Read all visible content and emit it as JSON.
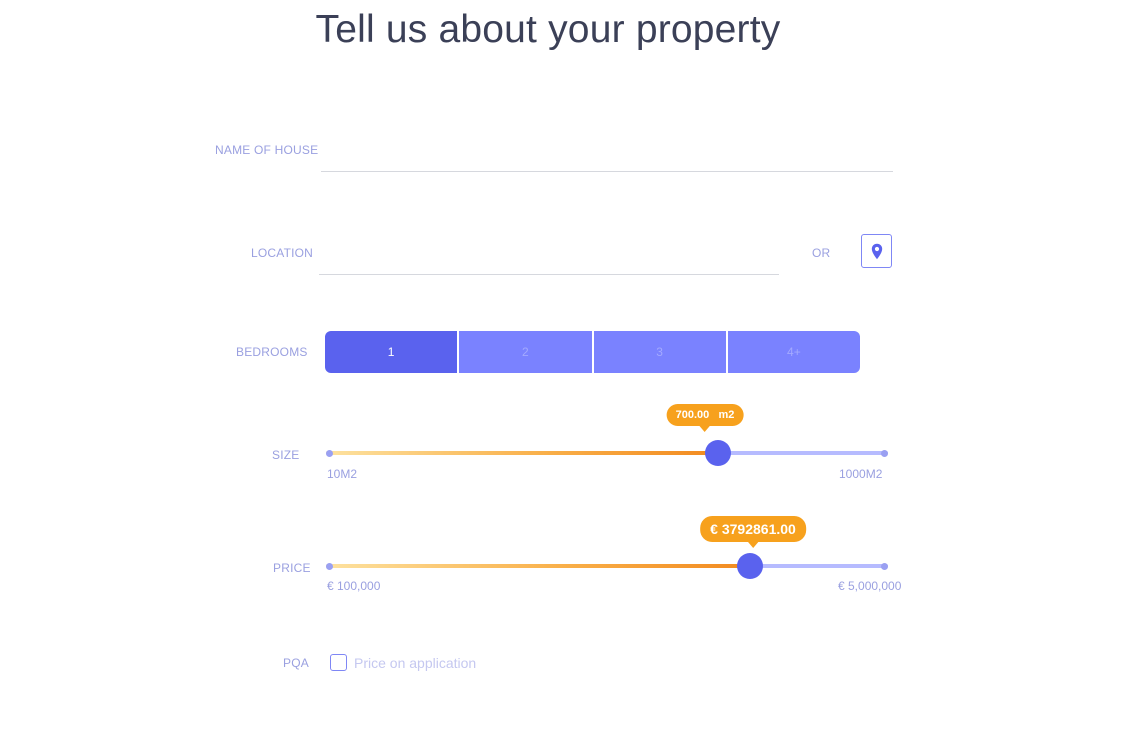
{
  "page": {
    "title": "Tell us about your property"
  },
  "form": {
    "name_of_house": {
      "label": "NAME OF HOUSE",
      "value": "",
      "placeholder": ""
    },
    "location": {
      "label": "LOCATION",
      "value": "",
      "placeholder": "",
      "or_label": "OR",
      "pin_icon": "location-pin-icon"
    },
    "bedrooms": {
      "label": "BEDROOMS",
      "options": [
        "1",
        "2",
        "3",
        "4+"
      ],
      "selected": "1"
    },
    "size": {
      "label": "SIZE",
      "min_label": "10M2",
      "max_label": "1000M2",
      "tooltip_value": "700.00",
      "tooltip_unit": "m2",
      "min": 10,
      "max": 1000,
      "value": 700
    },
    "price": {
      "label": "PRICE",
      "min_label": "€ 100,000",
      "max_label": "€ 5,000,000",
      "tooltip_value": "€  3792861.00",
      "min": 100000,
      "max": 5000000,
      "value": 3792861
    },
    "pqa": {
      "label": "PQA",
      "checkbox_label": "Price on application",
      "checked": false
    }
  },
  "colors": {
    "accent": "#5a62ee",
    "accent_light": "#7a82ff",
    "orange": "#f7a11d",
    "label": "#9aa0e0"
  }
}
